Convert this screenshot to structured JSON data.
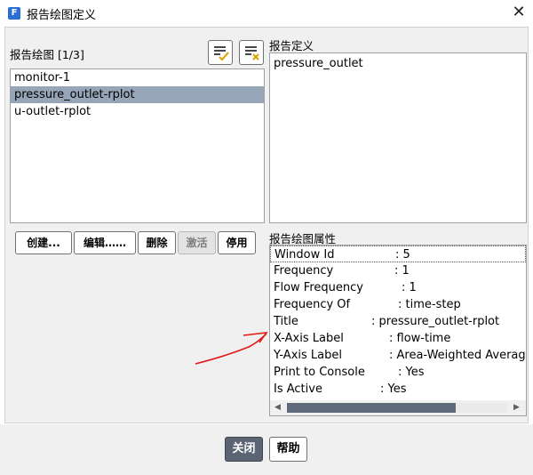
{
  "window": {
    "title": "报告绘图定义",
    "app_icon_letter": "F",
    "close_glyph": "✕"
  },
  "left_panel": {
    "label": "报告绘图 [1/3]",
    "items": [
      "monitor-1",
      "pressure_outlet-rplot",
      "u-outlet-rplot"
    ],
    "selected_index": 1
  },
  "right_top": {
    "label": "报告定义",
    "items": [
      "pressure_outlet"
    ]
  },
  "buttons": {
    "create": "创建...",
    "edit": "编辑……",
    "delete": "删除",
    "activate": "激活",
    "deactivate": "停用"
  },
  "properties": {
    "label": "报告绘图属性",
    "rows": [
      {
        "key": "Window Id",
        "value": ": 5"
      },
      {
        "key": "Frequency",
        "value": ": 1"
      },
      {
        "key": "Flow Frequency",
        "value": ": 1"
      },
      {
        "key": "Frequency Of",
        "value": ": time-step"
      },
      {
        "key": "Title",
        "value": ": pressure_outlet-rplot"
      },
      {
        "key": "X-Axis Label",
        "value": ": flow-time"
      },
      {
        "key": "Y-Axis Label",
        "value": ": Area-Weighted Average"
      },
      {
        "key": "Print to Console",
        "value": ": Yes"
      },
      {
        "key": "Is Active",
        "value": ": Yes"
      }
    ]
  },
  "footer": {
    "close": "关闭",
    "help": "帮助"
  },
  "colors": {
    "selected_row": "#97a5b8",
    "accent_blue": "#2b6fd6",
    "annotation_red": "#e01818",
    "close_button_bg": "#5a6473"
  },
  "icons": [
    "select-all-icon",
    "deselect-all-icon",
    "close-icon",
    "scroll-left-icon",
    "scroll-right-icon"
  ]
}
